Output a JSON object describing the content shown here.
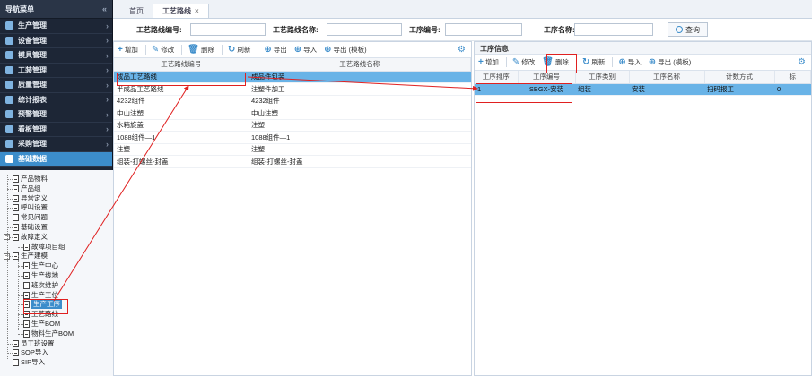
{
  "sidebar": {
    "title": "导航菜单",
    "collapse_icon": "«",
    "items": [
      {
        "label": "生产管理",
        "color": "#7fb3e0"
      },
      {
        "label": "设备管理",
        "color": "#7fb3e0"
      },
      {
        "label": "模具管理",
        "color": "#7fb3e0"
      },
      {
        "label": "工装管理",
        "color": "#7fb3e0"
      },
      {
        "label": "质量管理",
        "color": "#7fb3e0"
      },
      {
        "label": "统计报表",
        "color": "#7fb3e0"
      },
      {
        "label": "预警管理",
        "color": "#7fb3e0"
      },
      {
        "label": "看板管理",
        "color": "#7fb3e0"
      },
      {
        "label": "采购管理",
        "color": "#7fb3e0"
      },
      {
        "label": "基础数据",
        "color": "#ffffff"
      }
    ],
    "tree": [
      "产品物料",
      "产品组",
      "异常定义",
      "呼叫设置",
      "常见问题",
      "基础设置",
      "故障定义",
      "故障项目组",
      "生产建模",
      "生产中心",
      "生产线地",
      "班次维护",
      "生产工位",
      "生产工序",
      "工艺路线",
      "生产BOM",
      "物料生产BOM",
      "员工班设置",
      "SOP导入",
      "SIP导入"
    ]
  },
  "tabs": [
    {
      "label": "首页"
    },
    {
      "label": "工艺路线",
      "close": "×"
    }
  ],
  "search": {
    "route_code_label": "工艺路线编号:",
    "route_name_label": "工艺路线名称:",
    "process_code_label": "工序编号:",
    "process_name_label": "工序名称:",
    "query_label": "查询"
  },
  "left_toolbar": {
    "add": "增加",
    "edit": "修改",
    "delete": "删除",
    "refresh": "刷新",
    "export": "导出",
    "import": "导入",
    "export_template": "导出 (模板)"
  },
  "left_table": {
    "headers": [
      "工艺路线编号",
      "工艺路线名称"
    ],
    "rows": [
      [
        "成品工艺路线",
        "成品件包装"
      ],
      [
        "半成品工艺路线",
        "注塑件加工"
      ],
      [
        "4232组件",
        "4232组件"
      ],
      [
        "中山注塑",
        "中山注塑"
      ],
      [
        "水箱旋盖",
        "注塑"
      ],
      [
        "1088组件—1",
        "1088组件—1"
      ],
      [
        "注塑",
        "注塑"
      ],
      [
        "组装-打螺丝-封盖",
        "组装-打螺丝-封盖"
      ]
    ]
  },
  "right_panel": {
    "title": "工序信息",
    "toolbar": {
      "add": "增加",
      "edit": "修改",
      "delete": "删除",
      "refresh": "刷新",
      "import": "导入",
      "export_template": "导出 (模板)"
    },
    "headers": [
      "工序排序",
      "工序编号",
      "工序类别",
      "工序名称",
      "计数方式",
      "标"
    ],
    "rows": [
      [
        "1",
        "SBGX-安装",
        "组装",
        "安装",
        "扫码报工",
        "0"
      ]
    ]
  },
  "colors": {
    "accent": "#3c8dcb",
    "selected_row": "#69b3e7",
    "annotation": "#e02020"
  }
}
